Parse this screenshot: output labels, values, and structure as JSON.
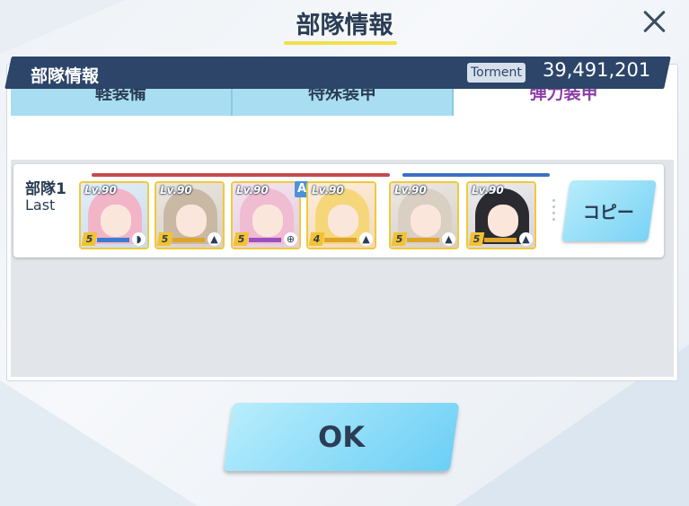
{
  "dialog": {
    "title": "部隊情報",
    "close_icon": "close-icon"
  },
  "tabs": [
    {
      "label": "軽装備",
      "active": false
    },
    {
      "label": "特殊装甲",
      "active": false
    },
    {
      "label": "弾力装甲",
      "active": true
    }
  ],
  "info_bar": {
    "label": "部隊情報",
    "badge": "Torment",
    "score": "39,491,201"
  },
  "team": {
    "name": "部隊1",
    "subtitle": "Last",
    "members": [
      {
        "level": "Lv.90",
        "star": "5",
        "role_icon": "shield-icon",
        "role_glyph": "◗",
        "bar_color": "#3c7bd0"
      },
      {
        "level": "Lv.90",
        "star": "5",
        "role_icon": "support-icon",
        "role_glyph": "▲",
        "bar_color": "#e0a42a"
      },
      {
        "level": "Lv.90",
        "star": "5",
        "role_icon": "target-icon",
        "role_glyph": "⊕",
        "bar_color": "#9b4fc0",
        "badge": "A"
      },
      {
        "level": "Lv.90",
        "star": "4",
        "role_icon": "support-icon",
        "role_glyph": "▲",
        "bar_color": "#e0a42a"
      },
      {
        "level": "Lv.90",
        "star": "5",
        "role_icon": "support-icon",
        "role_glyph": "▲",
        "bar_color": "#e0a42a"
      },
      {
        "level": "Lv.90",
        "star": "5",
        "role_icon": "support-icon",
        "role_glyph": "▲",
        "bar_color": "#e0a42a"
      }
    ]
  },
  "buttons": {
    "copy": "コピー",
    "ok": "OK"
  },
  "colors": {
    "accent": "#f1e04b",
    "header": "#2c4569",
    "active_tab_text": "#8b3fa6",
    "button": "#7ad3f5"
  }
}
